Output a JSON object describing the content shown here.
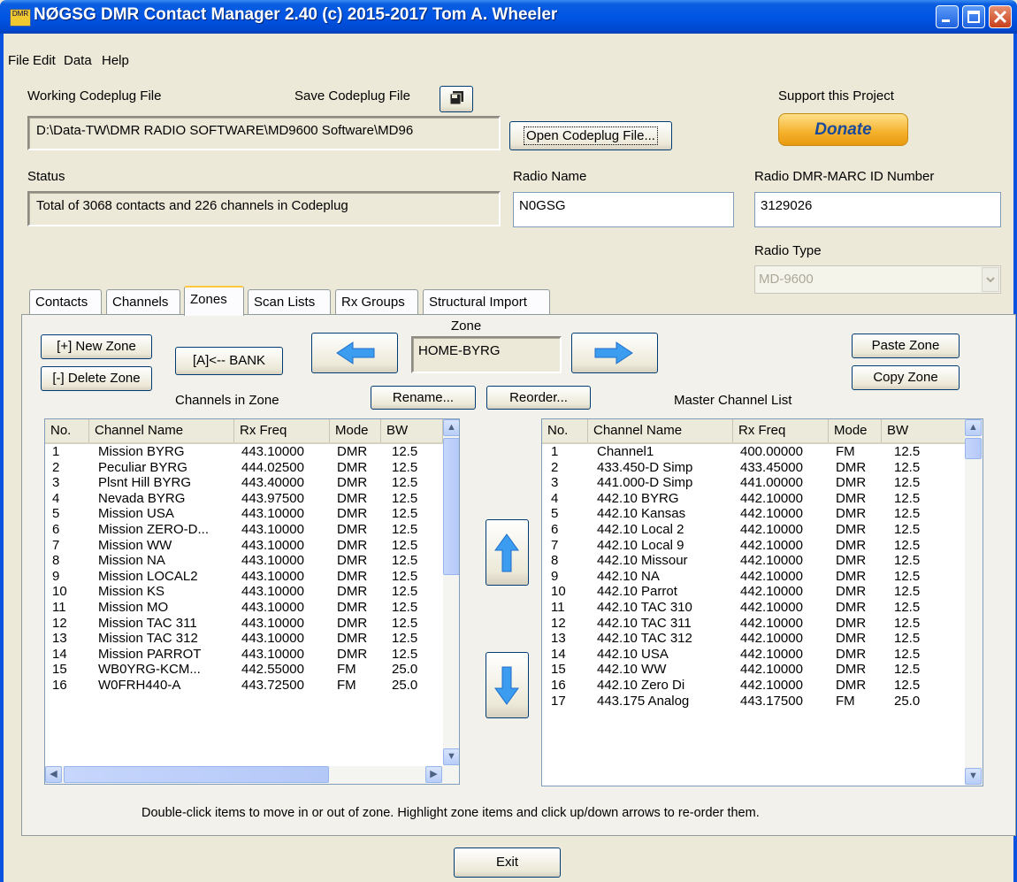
{
  "window": {
    "title": "NØGSG DMR Contact Manager 2.40 (c) 2015-2017 Tom A. Wheeler",
    "app_icon_text": "DMR"
  },
  "menu": [
    "File",
    "Edit",
    "Data",
    "Help"
  ],
  "top": {
    "working_label": "Working Codeplug File",
    "save_label": "Save Codeplug File",
    "file_path": "D:\\Data-TW\\DMR RADIO SOFTWARE\\MD9600 Software\\MD96",
    "open_button": "Open Codeplug File...",
    "support_label": "Support this Project",
    "donate": "Donate",
    "status_label": "Status",
    "status_text": "Total of 3068 contacts and 226 channels in Codeplug",
    "radio_name_label": "Radio Name",
    "radio_name": "N0GSG",
    "marc_label": "Radio DMR-MARC ID Number",
    "marc_id": "3129026",
    "radio_type_label": "Radio Type",
    "radio_type": "MD-9600"
  },
  "tabs": [
    "Contacts",
    "Channels",
    "Zones",
    "Scan Lists",
    "Rx Groups",
    "Structural Import"
  ],
  "active_tab": "Zones",
  "zones": {
    "new_zone": "[+] New Zone",
    "delete_zone": "[-] Delete Zone",
    "bank": "[A]<-- BANK",
    "zone_label": "Zone",
    "zone_name": "HOME-BYRG",
    "paste_zone": "Paste Zone",
    "copy_zone": "Copy Zone",
    "channels_in_zone": "Channels in Zone",
    "rename": "Rename...",
    "reorder": "Reorder...",
    "master_label": "Master Channel List",
    "columns": [
      "No.",
      "Channel Name",
      "Rx Freq",
      "Mode",
      "BW"
    ],
    "zone_rows": [
      [
        "1",
        "Mission BYRG",
        "443.10000",
        "DMR",
        "12.5"
      ],
      [
        "2",
        "Peculiar BYRG",
        "444.02500",
        "DMR",
        "12.5"
      ],
      [
        "3",
        "Plsnt Hill BYRG",
        "443.40000",
        "DMR",
        "12.5"
      ],
      [
        "4",
        "Nevada BYRG",
        "443.97500",
        "DMR",
        "12.5"
      ],
      [
        "5",
        "Mission USA",
        "443.10000",
        "DMR",
        "12.5"
      ],
      [
        "6",
        "Mission ZERO-D...",
        "443.10000",
        "DMR",
        "12.5"
      ],
      [
        "7",
        "Mission WW",
        "443.10000",
        "DMR",
        "12.5"
      ],
      [
        "8",
        "Mission NA",
        "443.10000",
        "DMR",
        "12.5"
      ],
      [
        "9",
        "Mission LOCAL2",
        "443.10000",
        "DMR",
        "12.5"
      ],
      [
        "10",
        "Mission KS",
        "443.10000",
        "DMR",
        "12.5"
      ],
      [
        "11",
        "Mission MO",
        "443.10000",
        "DMR",
        "12.5"
      ],
      [
        "12",
        "Mission TAC 311",
        "443.10000",
        "DMR",
        "12.5"
      ],
      [
        "13",
        "Mission TAC 312",
        "443.10000",
        "DMR",
        "12.5"
      ],
      [
        "14",
        "Mission PARROT",
        "443.10000",
        "DMR",
        "12.5"
      ],
      [
        "15",
        "WB0YRG-KCM...",
        "442.55000",
        "FM",
        "25.0"
      ],
      [
        "16",
        "W0FRH440-A",
        "443.72500",
        "FM",
        "25.0"
      ]
    ],
    "master_rows": [
      [
        "1",
        "Channel1",
        "400.00000",
        "FM",
        "12.5"
      ],
      [
        "2",
        "433.450-D Simp",
        "433.45000",
        "DMR",
        "12.5"
      ],
      [
        "3",
        "441.000-D Simp",
        "441.00000",
        "DMR",
        "12.5"
      ],
      [
        "4",
        "442.10 BYRG",
        "442.10000",
        "DMR",
        "12.5"
      ],
      [
        "5",
        "442.10 Kansas",
        "442.10000",
        "DMR",
        "12.5"
      ],
      [
        "6",
        "442.10 Local 2",
        "442.10000",
        "DMR",
        "12.5"
      ],
      [
        "7",
        "442.10 Local 9",
        "442.10000",
        "DMR",
        "12.5"
      ],
      [
        "8",
        "442.10 Missour",
        "442.10000",
        "DMR",
        "12.5"
      ],
      [
        "9",
        "442.10 NA",
        "442.10000",
        "DMR",
        "12.5"
      ],
      [
        "10",
        "442.10 Parrot",
        "442.10000",
        "DMR",
        "12.5"
      ],
      [
        "11",
        "442.10 TAC 310",
        "442.10000",
        "DMR",
        "12.5"
      ],
      [
        "12",
        "442.10 TAC 311",
        "442.10000",
        "DMR",
        "12.5"
      ],
      [
        "13",
        "442.10 TAC 312",
        "442.10000",
        "DMR",
        "12.5"
      ],
      [
        "14",
        "442.10 USA",
        "442.10000",
        "DMR",
        "12.5"
      ],
      [
        "15",
        "442.10 WW",
        "442.10000",
        "DMR",
        "12.5"
      ],
      [
        "16",
        "442.10 Zero Di",
        "442.10000",
        "DMR",
        "12.5"
      ],
      [
        "17",
        "443.175 Analog",
        "443.17500",
        "FM",
        "25.0"
      ]
    ],
    "hint": "Double-click items to move in or out of zone. Highlight zone items and click up/down arrows to re-order them."
  },
  "exit": "Exit",
  "colors": {
    "titlebar": "#0055e5",
    "arrow": "#3c9cf0",
    "donate": "#f5b02a"
  }
}
